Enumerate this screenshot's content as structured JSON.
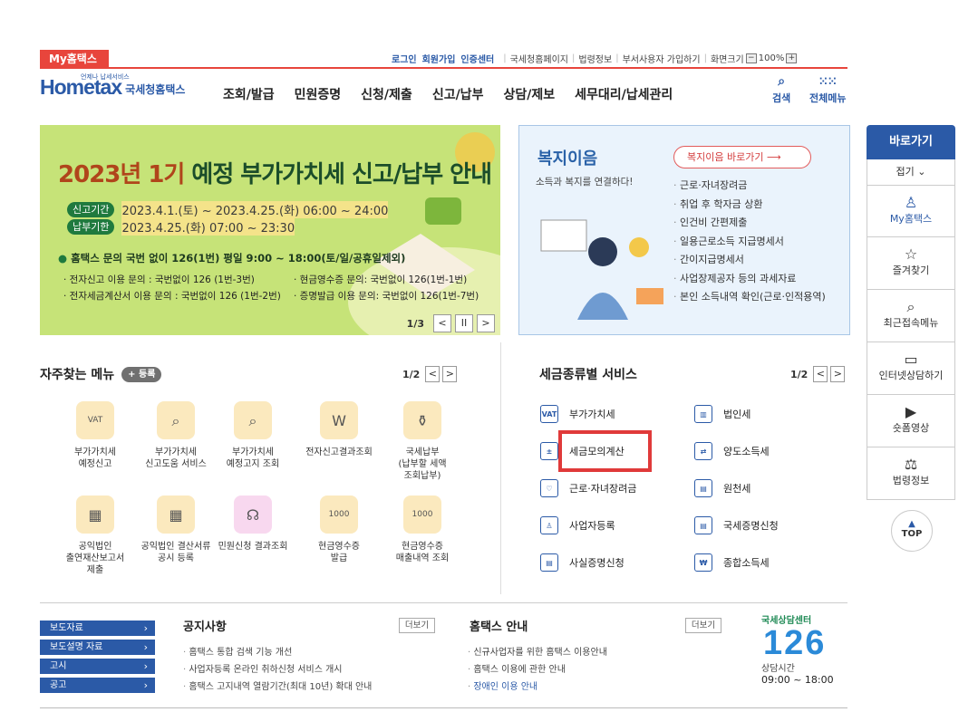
{
  "topbar": {
    "my_tab": "My홈택스",
    "login": "로그인",
    "join": "회원가입",
    "cert": "인증센터",
    "links": [
      "국세청홈페이지",
      "법령정보",
      "부서사용자 가입하기"
    ],
    "zoom_label": "화면크기",
    "zoom_minus": "−",
    "zoom_value": "100%",
    "zoom_plus": "+"
  },
  "logo": {
    "small": "언제나 납세서비스",
    "main": "Hometax",
    "sub": "국세청홈택스"
  },
  "nav": [
    "조회/발급",
    "민원증명",
    "신청/제출",
    "신고/납부",
    "상담/제보",
    "세무대리/납세관리"
  ],
  "tools": {
    "search": "검색",
    "menu": "전체메뉴"
  },
  "banner": {
    "title_year": "2023년 1기",
    "title_rest": " 예정 부가가치세 신고/납부 안내",
    "period1_tag": "신고기간",
    "period1": "2023.4.1.(토) ~ 2023.4.25.(화) 06:00 ~ 24:00",
    "period2_tag": "납부기한",
    "period2": "2023.4.25.(화) 07:00 ~ 23:30",
    "call": "홈택스 문의 국번 없이 126(1번) 평일 9:00 ~ 18:00(토/일/공휴일제외)",
    "lines": [
      "· 전자신고 이용 문의 : 국번없이 126 (1번-3번)",
      "· 현금영수증 문의: 국번없이 126(1번-1번)",
      "· 전자세금계산서 이용 문의 : 국번없이 126 (1번-2번)",
      "· 증명발급 이용 문의: 국번없이 126(1번-7번)"
    ],
    "page": "1/3",
    "prev": "<",
    "pause": "II",
    "next": ">"
  },
  "welfare": {
    "title": "복지이음",
    "subtitle": "소득과 복지를 연결하다!",
    "button": "복지이음 바로가기 ⟶",
    "items": [
      "근로·자녀장려금",
      "취업 후 학자금 상환",
      "인건비 간편제출",
      "일용근로소득 지급명세서",
      "간이지급명세서",
      "사업장제공자 등의 과세자료",
      "본인 소득내역 확인(근로·인적용역)"
    ]
  },
  "sidebar": {
    "header": "바로가기",
    "fold": "접기 ⌄",
    "items": [
      {
        "icon": "♙",
        "label": "My홈택스"
      },
      {
        "icon": "☆",
        "label": "즐겨찾기"
      },
      {
        "icon": "⌕",
        "label": "최근접속메뉴"
      },
      {
        "icon": "▭",
        "label": "인터넷상담하기"
      },
      {
        "icon": "▶",
        "label": "숏폼영상"
      },
      {
        "icon": "⚖",
        "label": "법령정보"
      }
    ],
    "top": "TOP"
  },
  "favorites": {
    "title": "자주찾는 메뉴",
    "register": "+ 등록",
    "page": "1/2",
    "prev": "<",
    "next": ">",
    "items": [
      {
        "icon": "VAT",
        "label": "부가가치세\n예정신고"
      },
      {
        "icon": "⌕",
        "label": "부가가치세\n신고도움 서비스"
      },
      {
        "icon": "⌕",
        "label": "부가가치세\n예정고지 조회"
      },
      {
        "icon": "W",
        "label": "전자신고결과조회"
      },
      {
        "icon": "⚱",
        "label": "국세납부\n(납부할 세액\n조회납부)"
      },
      {
        "icon": "▦",
        "label": "공익법인\n출연재산보고서\n제출"
      },
      {
        "icon": "▦",
        "label": "공익법인 결산서류\n공시 등록"
      },
      {
        "icon": "☊",
        "label": "민원신청 결과조회"
      },
      {
        "icon": "1000",
        "label": "현금영수증\n발급"
      },
      {
        "icon": "1000",
        "label": "현금영수증\n매출내역 조회"
      }
    ]
  },
  "taxservices": {
    "title": "세금종류별 서비스",
    "page": "1/2",
    "prev": "<",
    "next": ">",
    "items": [
      {
        "icon": "VAT",
        "label": "부가가치세"
      },
      {
        "icon": "▥",
        "label": "법인세"
      },
      {
        "icon": "±",
        "label": "세금모의계산"
      },
      {
        "icon": "⇄",
        "label": "양도소득세"
      },
      {
        "icon": "♡",
        "label": "근로·자녀장려금"
      },
      {
        "icon": "▤",
        "label": "원천세"
      },
      {
        "icon": "♙",
        "label": "사업자등록"
      },
      {
        "icon": "▤",
        "label": "국세증명신청"
      },
      {
        "icon": "▤",
        "label": "사실증명신청"
      },
      {
        "icon": "₩",
        "label": "종합소득세"
      }
    ]
  },
  "footer": {
    "side_buttons": [
      "보도자료",
      "보도설명 자료",
      "고시",
      "공고"
    ],
    "notice_title": "공지사항",
    "notice_more": "더보기",
    "notices": [
      "홈택스 통합 검색 기능 개선",
      "사업자등록 온라인 취하신청 서비스 개시",
      "홈택스 고지내역 열람기간(최대 10년) 확대 안내"
    ],
    "guide_title": "홈택스 안내",
    "guide_more": "더보기",
    "guides": [
      "신규사업자를 위한 홈택스 이용안내",
      "홈택스 이용에 관한 안내",
      "장애인 이용 안내"
    ],
    "center_title": "국세상담센터",
    "center_number": "126",
    "center_hours_label": "상담시간",
    "center_hours": "09:00 ~ 18:00"
  },
  "colors": {
    "brand": "#2b5aa7",
    "accent": "#e8453c",
    "highlight": "#e03a3a"
  }
}
